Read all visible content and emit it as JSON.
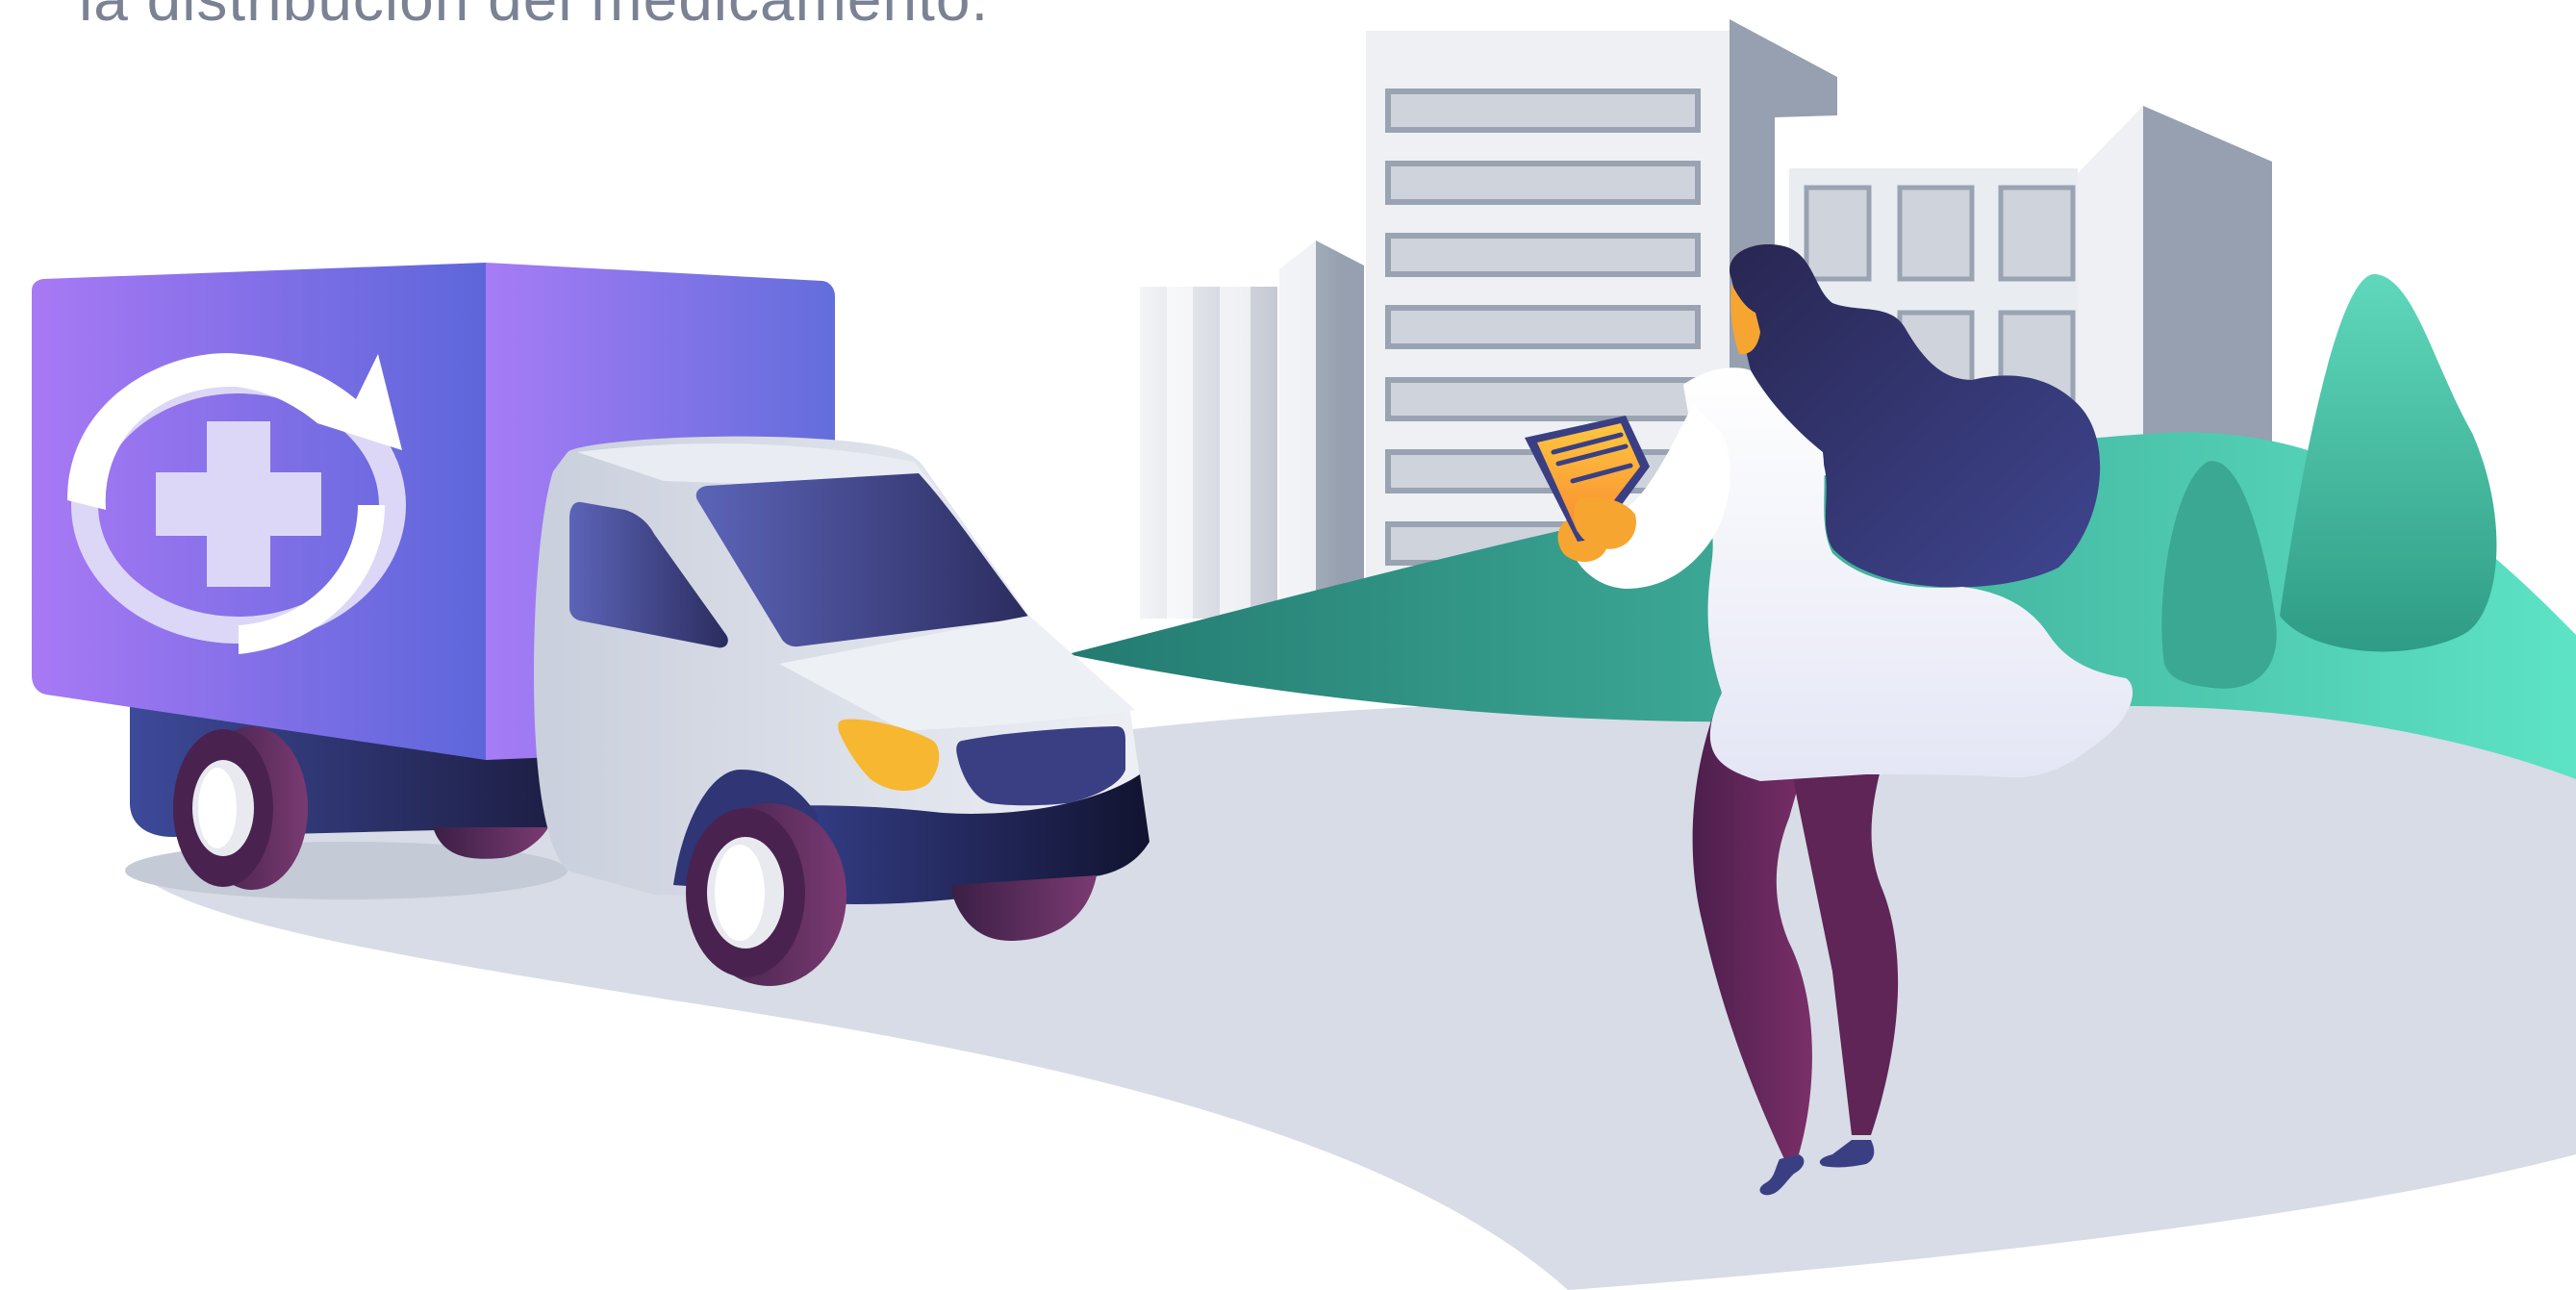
{
  "caption": {
    "text": "la distribución del medicamento."
  },
  "colors": {
    "road": "#d7dce6",
    "truck_box": "#8a6cf0",
    "truck_box_dark": "#5d62d8",
    "van_body": "#e6e9f0",
    "van_dark": "#2d2d5a",
    "wheel": "#5b2b5d",
    "headlight": "#f7b731",
    "grass": "#3aa591",
    "tree": "#4fc7ac",
    "building": "#d5d9e2",
    "building_dark": "#9aa3b2",
    "hair": "#2f2d5c",
    "coat": "#ffffff",
    "pants": "#6a2a5e",
    "clipboard": "#f7a531"
  },
  "icons": [
    "medical-cross-icon",
    "refresh-arrow-icon"
  ]
}
